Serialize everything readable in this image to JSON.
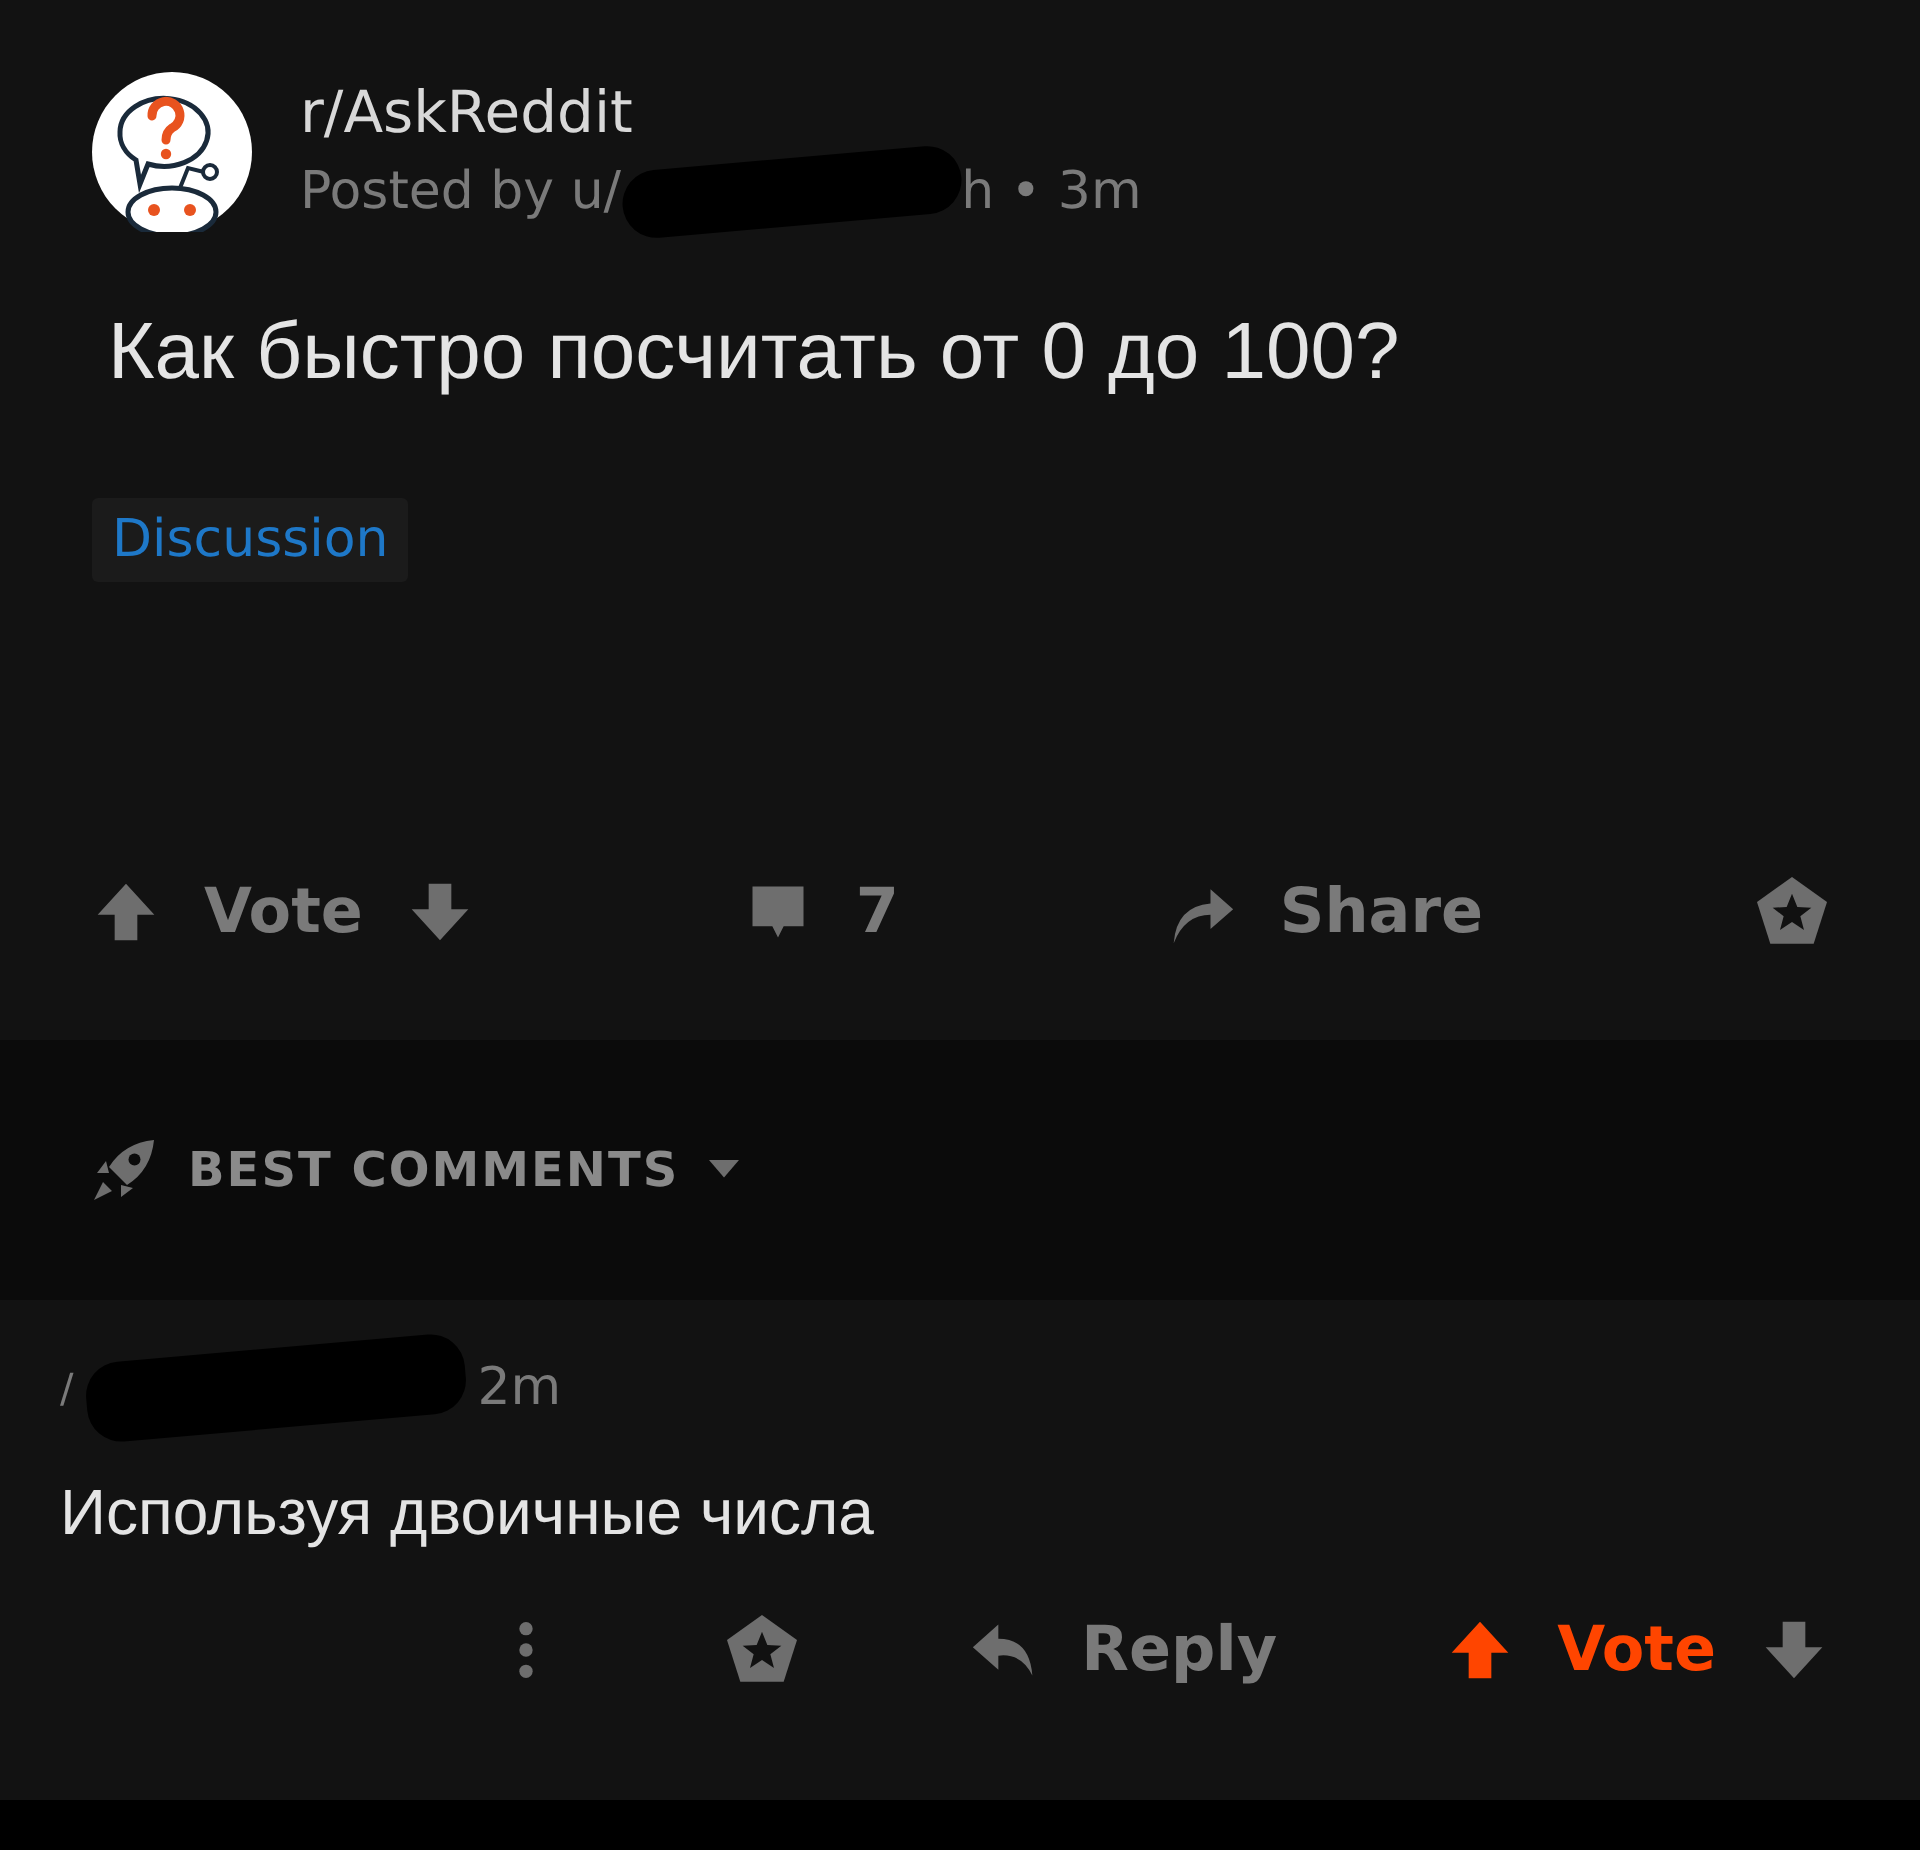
{
  "post": {
    "subreddit": "r/AskReddit",
    "posted_prefix": "Posted by u/",
    "posted_suffix": "h • 3m",
    "title": "Как быстро посчитать от 0 до 100?",
    "flair": "Discussion",
    "vote_label": "Vote",
    "upvoted": false,
    "comment_count": "7",
    "share_label": "Share"
  },
  "comments_header": {
    "label": "BEST COMMENTS"
  },
  "comments": [
    {
      "author_prefix": "/",
      "time": "2m",
      "body": "Используя двоичные числа",
      "reply_label": "Reply",
      "vote_label": "Vote",
      "upvoted": true
    }
  ]
}
